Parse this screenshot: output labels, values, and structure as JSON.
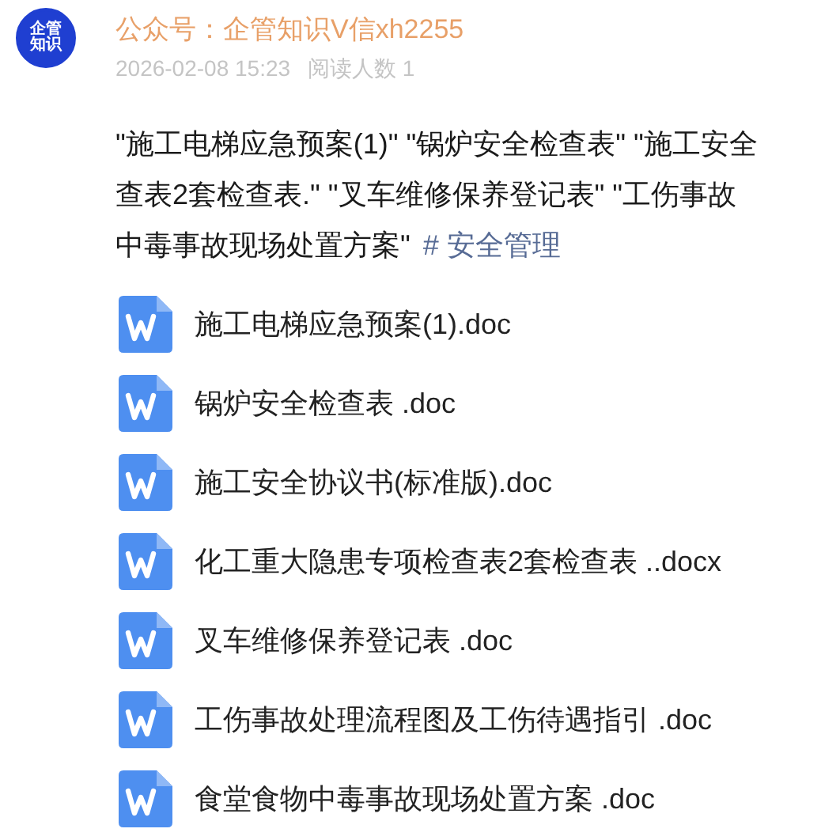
{
  "header": {
    "logo_text": "企管知识",
    "account": "公众号：企管知识V信xh2255",
    "date": "2026-02-08 15:23",
    "reads": "阅读人数 1"
  },
  "body": {
    "lines": [
      "\"施工电梯应急预案(1)\" \"锅炉安全检查表\" \"施工安全",
      "查表2套检查表.\" \"叉车维修保养登记表\" \"工伤事故",
      "中毒事故现场处置方案\""
    ],
    "hashtag": "# 安全管理"
  },
  "files": [
    {
      "name": "施工电梯应急预案(1).doc",
      "kind": "word"
    },
    {
      "name": "锅炉安全检查表 .doc",
      "kind": "word"
    },
    {
      "name": "施工安全协议书(标准版).doc",
      "kind": "word"
    },
    {
      "name": "化工重大隐患专项检查表2套检查表 ..docx",
      "kind": "word"
    },
    {
      "name": "叉车维修保养登记表 .doc",
      "kind": "word"
    },
    {
      "name": "工伤事故处理流程图及工伤待遇指引 .doc",
      "kind": "word"
    },
    {
      "name": "食堂食物中毒事故现场处置方案 .doc",
      "kind": "word"
    }
  ]
}
